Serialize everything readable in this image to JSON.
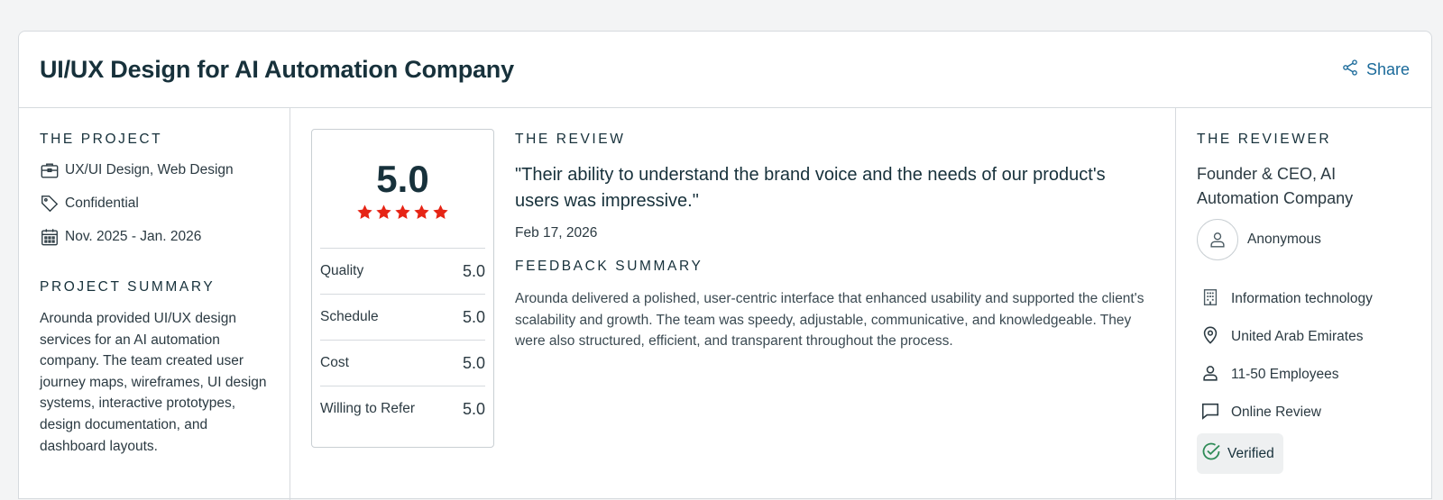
{
  "header": {
    "title": "UI/UX Design for AI Automation Company",
    "share_label": "Share"
  },
  "project": {
    "section_label": "THE PROJECT",
    "services": "UX/UI Design, Web Design",
    "budget": "Confidential",
    "dates": "Nov. 2025 - Jan. 2026",
    "summary_label": "PROJECT SUMMARY",
    "summary": "Arounda provided UI/UX design services for an AI automation company. The team created user journey maps, wireframes, UI design systems, interactive prototypes, design documentation, and dashboard layouts."
  },
  "rating": {
    "overall": "5.0",
    "stars": 5,
    "rows": [
      {
        "label": "Quality",
        "value": "5.0"
      },
      {
        "label": "Schedule",
        "value": "5.0"
      },
      {
        "label": "Cost",
        "value": "5.0"
      },
      {
        "label": "Willing to Refer",
        "value": "5.0"
      }
    ]
  },
  "review": {
    "section_label": "THE REVIEW",
    "quote": "\"Their ability to understand the brand voice and the needs of our product's users was impressive.\"",
    "date": "Feb 17, 2026",
    "feedback_label": "FEEDBACK SUMMARY",
    "feedback": "Arounda delivered a polished, user-centric interface that enhanced usability and supported the client's scalability and growth. The team was speedy, adjustable, communicative, and knowledgeable. They were also structured, efficient, and transparent throughout the process."
  },
  "reviewer": {
    "section_label": "THE REVIEWER",
    "role": "Founder & CEO, AI Automation Company",
    "name": "Anonymous",
    "industry": "Information technology",
    "location": "United Arab Emirates",
    "size": "11-50 Employees",
    "review_type": "Online Review",
    "verified_label": "Verified"
  },
  "colors": {
    "star": "#e62415",
    "link": "#1a6a9a",
    "verified_check": "#2e8b57"
  }
}
